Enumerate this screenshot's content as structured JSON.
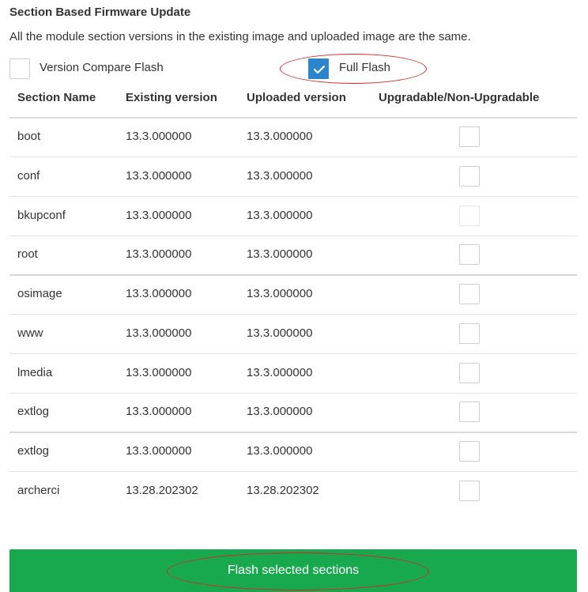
{
  "header": {
    "title": "Section Based Firmware Update",
    "description": "All the module section versions in the existing image and uploaded image are the same."
  },
  "options": {
    "version_compare": {
      "label": "Version Compare Flash",
      "checked": false
    },
    "full_flash": {
      "label": "Full Flash",
      "checked": true
    }
  },
  "table": {
    "columns": [
      "Section Name",
      "Existing version",
      "Uploaded version",
      "Upgradable/Non-Upgradable"
    ],
    "rows": [
      {
        "name": "boot",
        "existing": "13.3.000000",
        "uploaded": "13.3.000000",
        "selected": false
      },
      {
        "name": "conf",
        "existing": "13.3.000000",
        "uploaded": "13.3.000000",
        "selected": false
      },
      {
        "name": "bkupconf",
        "existing": "13.3.000000",
        "uploaded": "13.3.000000",
        "selected": false
      },
      {
        "name": "root",
        "existing": "13.3.000000",
        "uploaded": "13.3.000000",
        "selected": false
      },
      {
        "name": "osimage",
        "existing": "13.3.000000",
        "uploaded": "13.3.000000",
        "selected": false
      },
      {
        "name": "www",
        "existing": "13.3.000000",
        "uploaded": "13.3.000000",
        "selected": false
      },
      {
        "name": "lmedia",
        "existing": "13.3.000000",
        "uploaded": "13.3.000000",
        "selected": false
      },
      {
        "name": "extlog",
        "existing": "13.3.000000",
        "uploaded": "13.3.000000",
        "selected": false
      },
      {
        "name": "extlog",
        "existing": "13.3.000000",
        "uploaded": "13.3.000000",
        "selected": false
      },
      {
        "name": "archerci",
        "existing": "13.28.202302",
        "uploaded": "13.28.202302",
        "selected": false
      }
    ]
  },
  "actions": {
    "flash_button_label": "Flash selected sections"
  },
  "colors": {
    "accent_blue": "#2a85cc",
    "button_green": "#18a84d",
    "highlight_red": "#d9262c"
  }
}
